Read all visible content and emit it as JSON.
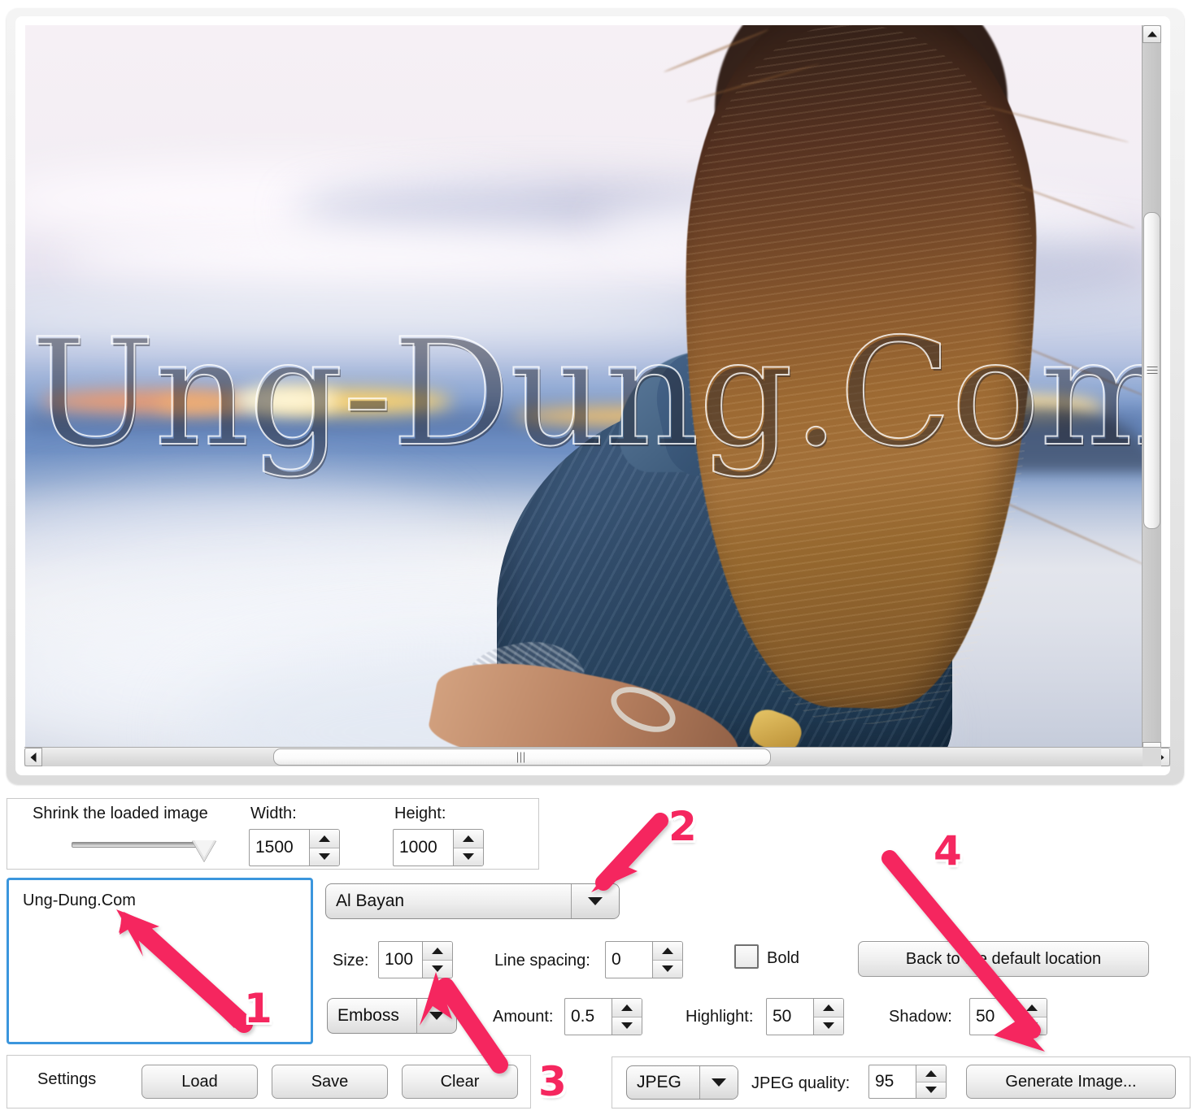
{
  "app": {
    "watermark_text": "Ung-Dung.Com"
  },
  "viewer": {
    "vscroll_up_icon": "triangle-up-icon",
    "vscroll_down_icon": "triangle-down-icon",
    "hscroll_left_icon": "triangle-left-icon",
    "hscroll_right_icon": "triangle-right-icon"
  },
  "shrink_panel": {
    "title": "Shrink the loaded  image",
    "width_label": "Width:",
    "width_value": "1500",
    "height_label": "Height:",
    "height_value": "1000"
  },
  "text_panel": {
    "value": "Ung-Dung.Com"
  },
  "font_panel": {
    "font_value": "Al Bayan",
    "size_label": "Size:",
    "size_value": "100",
    "line_spacing_label": "Line spacing:",
    "line_spacing_value": "0",
    "bold_label": "Bold",
    "default_location_button": "Back to the default location",
    "effect_value": "Emboss",
    "amount_label": "Amount:",
    "amount_value": "0.5",
    "highlight_label": "Highlight:",
    "highlight_value": "50",
    "shadow_label": "Shadow:",
    "shadow_value": "50"
  },
  "settings_panel": {
    "label": "Settings",
    "load_button": "Load",
    "save_button": "Save",
    "clear_button": "Clear"
  },
  "output_panel": {
    "format_value": "JPEG",
    "quality_label": "JPEG quality:",
    "quality_value": "95",
    "generate_button": "Generate Image..."
  },
  "annotations": {
    "one": "1",
    "two": "2",
    "three": "3",
    "four": "4",
    "color": "#f5275f"
  }
}
